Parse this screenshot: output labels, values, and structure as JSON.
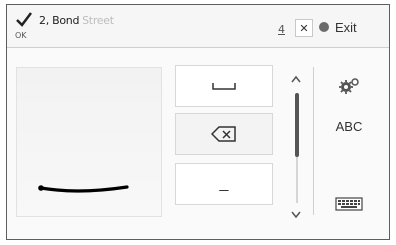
{
  "header": {
    "confirm_label": "OK",
    "typed_text": "2, Bond",
    "suggestion": "Street",
    "count": "4",
    "clear_label": "✕",
    "exit_label": "Exit"
  },
  "keys": {
    "underscore_label": "_"
  },
  "side": {
    "abc_label": "ABC"
  },
  "colors": {
    "stroke": "#000000",
    "border": "#5e5e5e",
    "hint": "#bdbdbd"
  },
  "icons": [
    "checkmark-icon",
    "clear-icon",
    "exit-icon",
    "space-icon",
    "backspace-icon",
    "settings-gear-icon",
    "keyboard-icon",
    "scroll-up-icon",
    "scroll-down-icon"
  ]
}
